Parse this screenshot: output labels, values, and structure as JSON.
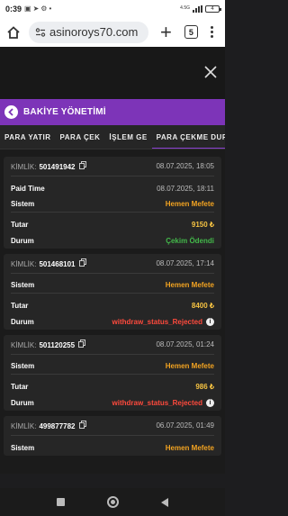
{
  "statusbar": {
    "time": "0:39",
    "network": "4.5G",
    "battery": "4"
  },
  "browser": {
    "url": "asinoroys70.com",
    "tab_count": "5"
  },
  "dialog": {
    "title": "BAKİYE YÖNETİMİ"
  },
  "tabs": [
    "PARA YATIR",
    "PARA ÇEK",
    "İŞLEM GE",
    "PARA ÇEKME DURUMU"
  ],
  "active_tab": 3,
  "labels": {
    "kimlik": "KİMLİK:",
    "paid_time": "Paid Time",
    "sistem": "Sistem",
    "tutar": "Tutar",
    "durum": "Durum"
  },
  "records": [
    {
      "id": "501491942",
      "date": "08.07.2025, 18:05",
      "paid_time": "08.07.2025, 18:11",
      "sistem": "Hemen Mefete",
      "tutar": "9150 ₺",
      "durum": "Çekim Ödendi"
    },
    {
      "id": "501468101",
      "date": "08.07.2025, 17:14",
      "sistem": "Hemen Mefete",
      "tutar": "8400 ₺",
      "durum": "withdraw_status_Rejected"
    },
    {
      "id": "501120255",
      "date": "08.07.2025, 01:24",
      "sistem": "Hemen Mefete",
      "tutar": "986 ₺",
      "durum": "withdraw_status_Rejected"
    },
    {
      "id": "499877782",
      "date": "06.07.2025, 01:49",
      "sistem": "Hemen Mefete"
    }
  ],
  "colors": {
    "accent": "#7d34b8",
    "pending": "#f2a321",
    "success": "#43b84a",
    "rejected": "#ff4a3d"
  }
}
